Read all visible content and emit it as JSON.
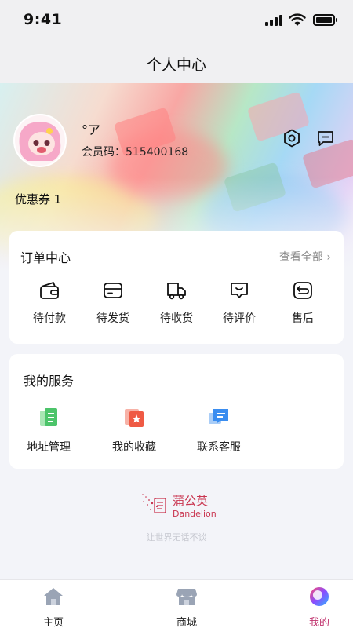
{
  "status_bar": {
    "time": "9:41"
  },
  "header": {
    "title": "个人中心"
  },
  "profile": {
    "nickname": "°ア",
    "member_id": "会员码：515400168",
    "coupon_text": "优惠券 1"
  },
  "orders": {
    "title": "订单中心",
    "view_all": "查看全部 ›",
    "items": [
      {
        "label": "待付款",
        "icon": "wallet-icon"
      },
      {
        "label": "待发货",
        "icon": "card-icon"
      },
      {
        "label": "待收货",
        "icon": "truck-icon"
      },
      {
        "label": "待评价",
        "icon": "comment-icon"
      },
      {
        "label": "售后",
        "icon": "return-icon"
      }
    ]
  },
  "services": {
    "title": "我的服务",
    "items": [
      {
        "label": "地址管理",
        "icon": "address-icon",
        "color": "#4cc46a"
      },
      {
        "label": "我的收藏",
        "icon": "favorite-icon",
        "color": "#ef5a44"
      },
      {
        "label": "联系客服",
        "icon": "customer-service-icon",
        "color": "#3a8df0"
      }
    ]
  },
  "branding": {
    "logo_cn": "蒲公英",
    "logo_en": "Dandelion",
    "slogan": "让世界无话不谈"
  },
  "tabbar": {
    "items": [
      {
        "label": "主页",
        "icon": "home-icon"
      },
      {
        "label": "商城",
        "icon": "store-icon"
      },
      {
        "label": "我的",
        "icon": "profile-icon",
        "active": true
      }
    ]
  },
  "colors": {
    "accent": "#c0316d",
    "background": "#f3f4f9"
  }
}
